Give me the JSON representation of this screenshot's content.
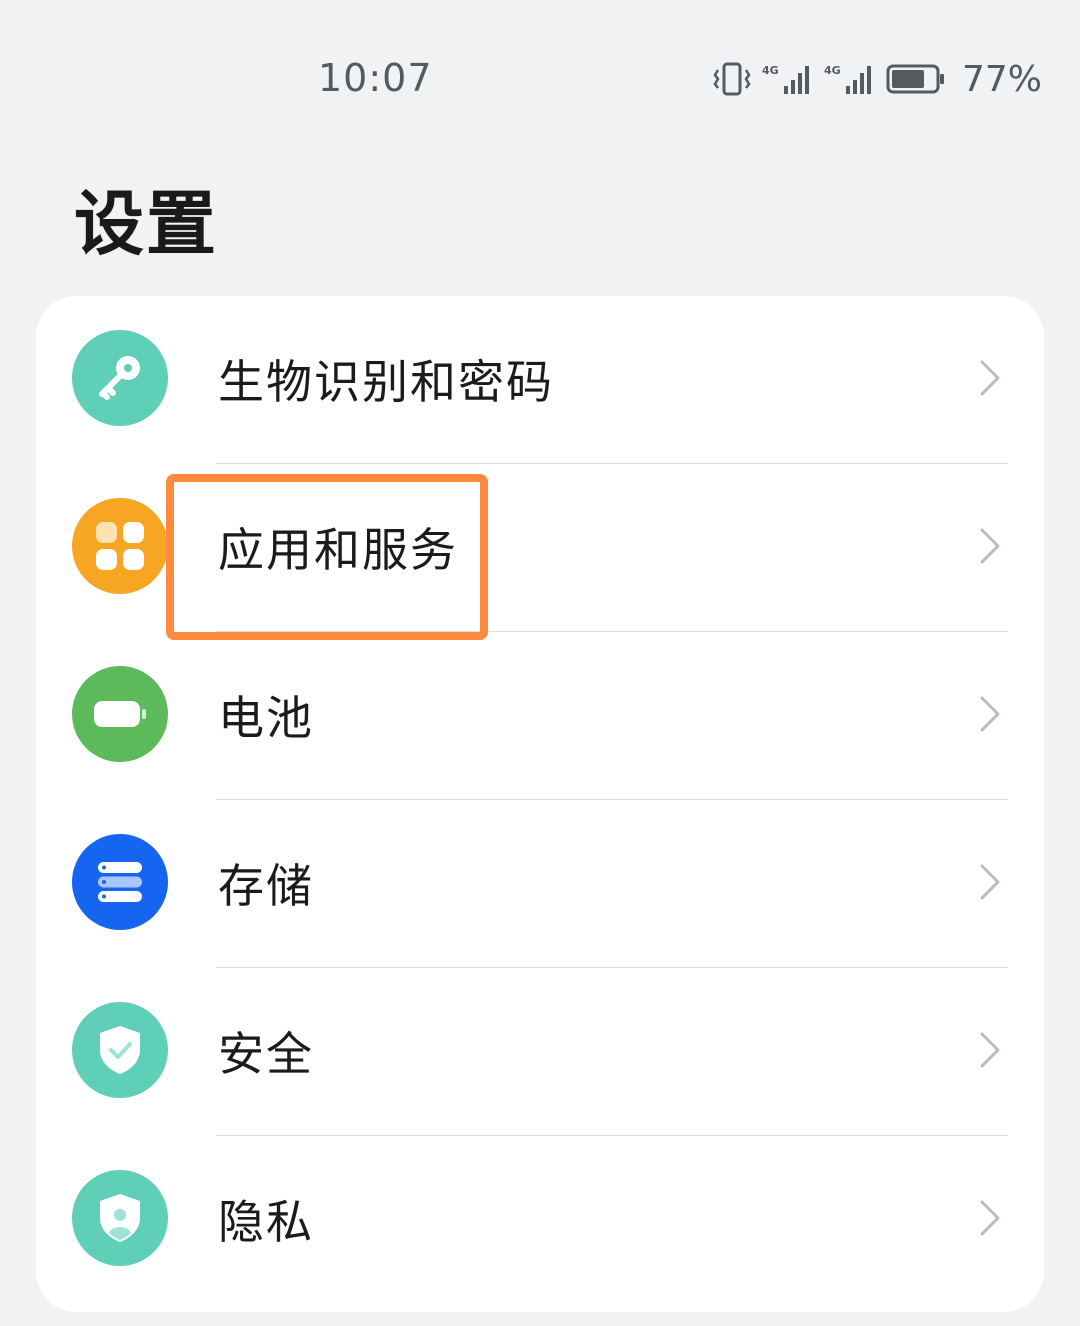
{
  "status_bar": {
    "time": "10:07",
    "network_1": "4G",
    "network_2": "4G",
    "battery_percent": "77%",
    "battery_level": 0.77
  },
  "page": {
    "title": "设置"
  },
  "settings": [
    {
      "label": "生物识别和密码",
      "icon": "key-icon",
      "color": "#5fcfb8"
    },
    {
      "label": "应用和服务",
      "icon": "apps-icon",
      "color": "#f6a623",
      "highlighted": true
    },
    {
      "label": "电池",
      "icon": "battery-icon",
      "color": "#5cba5a"
    },
    {
      "label": "存储",
      "icon": "storage-icon",
      "color": "#1565f0"
    },
    {
      "label": "安全",
      "icon": "shield-check-icon",
      "color": "#5fcfb8"
    },
    {
      "label": "隐私",
      "icon": "privacy-shield-icon",
      "color": "#5fcfb8"
    }
  ],
  "annotation": {
    "highlight_color": "#ff8a3d"
  }
}
